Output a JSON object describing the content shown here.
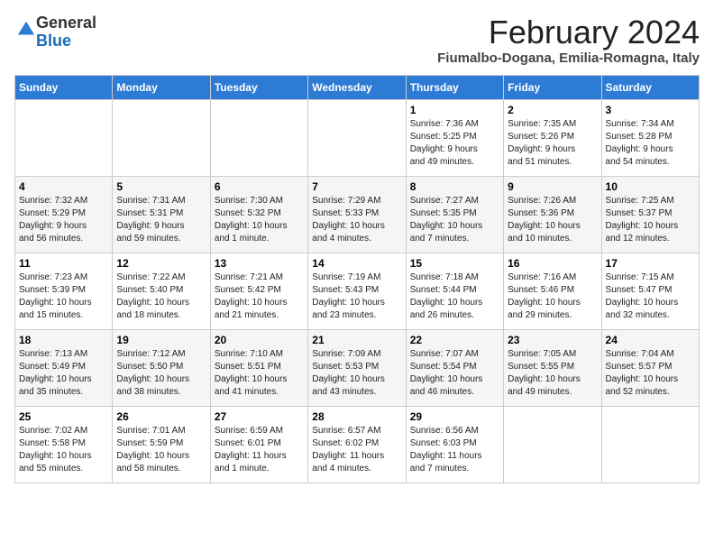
{
  "header": {
    "logo_general": "General",
    "logo_blue": "Blue",
    "main_title": "February 2024",
    "subtitle": "Fiumalbo-Dogana, Emilia-Romagna, Italy"
  },
  "days_of_week": [
    "Sunday",
    "Monday",
    "Tuesday",
    "Wednesday",
    "Thursday",
    "Friday",
    "Saturday"
  ],
  "weeks": [
    [
      {
        "day": "",
        "info": ""
      },
      {
        "day": "",
        "info": ""
      },
      {
        "day": "",
        "info": ""
      },
      {
        "day": "",
        "info": ""
      },
      {
        "day": "1",
        "info": "Sunrise: 7:36 AM\nSunset: 5:25 PM\nDaylight: 9 hours\nand 49 minutes."
      },
      {
        "day": "2",
        "info": "Sunrise: 7:35 AM\nSunset: 5:26 PM\nDaylight: 9 hours\nand 51 minutes."
      },
      {
        "day": "3",
        "info": "Sunrise: 7:34 AM\nSunset: 5:28 PM\nDaylight: 9 hours\nand 54 minutes."
      }
    ],
    [
      {
        "day": "4",
        "info": "Sunrise: 7:32 AM\nSunset: 5:29 PM\nDaylight: 9 hours\nand 56 minutes."
      },
      {
        "day": "5",
        "info": "Sunrise: 7:31 AM\nSunset: 5:31 PM\nDaylight: 9 hours\nand 59 minutes."
      },
      {
        "day": "6",
        "info": "Sunrise: 7:30 AM\nSunset: 5:32 PM\nDaylight: 10 hours\nand 1 minute."
      },
      {
        "day": "7",
        "info": "Sunrise: 7:29 AM\nSunset: 5:33 PM\nDaylight: 10 hours\nand 4 minutes."
      },
      {
        "day": "8",
        "info": "Sunrise: 7:27 AM\nSunset: 5:35 PM\nDaylight: 10 hours\nand 7 minutes."
      },
      {
        "day": "9",
        "info": "Sunrise: 7:26 AM\nSunset: 5:36 PM\nDaylight: 10 hours\nand 10 minutes."
      },
      {
        "day": "10",
        "info": "Sunrise: 7:25 AM\nSunset: 5:37 PM\nDaylight: 10 hours\nand 12 minutes."
      }
    ],
    [
      {
        "day": "11",
        "info": "Sunrise: 7:23 AM\nSunset: 5:39 PM\nDaylight: 10 hours\nand 15 minutes."
      },
      {
        "day": "12",
        "info": "Sunrise: 7:22 AM\nSunset: 5:40 PM\nDaylight: 10 hours\nand 18 minutes."
      },
      {
        "day": "13",
        "info": "Sunrise: 7:21 AM\nSunset: 5:42 PM\nDaylight: 10 hours\nand 21 minutes."
      },
      {
        "day": "14",
        "info": "Sunrise: 7:19 AM\nSunset: 5:43 PM\nDaylight: 10 hours\nand 23 minutes."
      },
      {
        "day": "15",
        "info": "Sunrise: 7:18 AM\nSunset: 5:44 PM\nDaylight: 10 hours\nand 26 minutes."
      },
      {
        "day": "16",
        "info": "Sunrise: 7:16 AM\nSunset: 5:46 PM\nDaylight: 10 hours\nand 29 minutes."
      },
      {
        "day": "17",
        "info": "Sunrise: 7:15 AM\nSunset: 5:47 PM\nDaylight: 10 hours\nand 32 minutes."
      }
    ],
    [
      {
        "day": "18",
        "info": "Sunrise: 7:13 AM\nSunset: 5:49 PM\nDaylight: 10 hours\nand 35 minutes."
      },
      {
        "day": "19",
        "info": "Sunrise: 7:12 AM\nSunset: 5:50 PM\nDaylight: 10 hours\nand 38 minutes."
      },
      {
        "day": "20",
        "info": "Sunrise: 7:10 AM\nSunset: 5:51 PM\nDaylight: 10 hours\nand 41 minutes."
      },
      {
        "day": "21",
        "info": "Sunrise: 7:09 AM\nSunset: 5:53 PM\nDaylight: 10 hours\nand 43 minutes."
      },
      {
        "day": "22",
        "info": "Sunrise: 7:07 AM\nSunset: 5:54 PM\nDaylight: 10 hours\nand 46 minutes."
      },
      {
        "day": "23",
        "info": "Sunrise: 7:05 AM\nSunset: 5:55 PM\nDaylight: 10 hours\nand 49 minutes."
      },
      {
        "day": "24",
        "info": "Sunrise: 7:04 AM\nSunset: 5:57 PM\nDaylight: 10 hours\nand 52 minutes."
      }
    ],
    [
      {
        "day": "25",
        "info": "Sunrise: 7:02 AM\nSunset: 5:58 PM\nDaylight: 10 hours\nand 55 minutes."
      },
      {
        "day": "26",
        "info": "Sunrise: 7:01 AM\nSunset: 5:59 PM\nDaylight: 10 hours\nand 58 minutes."
      },
      {
        "day": "27",
        "info": "Sunrise: 6:59 AM\nSunset: 6:01 PM\nDaylight: 11 hours\nand 1 minute."
      },
      {
        "day": "28",
        "info": "Sunrise: 6:57 AM\nSunset: 6:02 PM\nDaylight: 11 hours\nand 4 minutes."
      },
      {
        "day": "29",
        "info": "Sunrise: 6:56 AM\nSunset: 6:03 PM\nDaylight: 11 hours\nand 7 minutes."
      },
      {
        "day": "",
        "info": ""
      },
      {
        "day": "",
        "info": ""
      }
    ]
  ]
}
